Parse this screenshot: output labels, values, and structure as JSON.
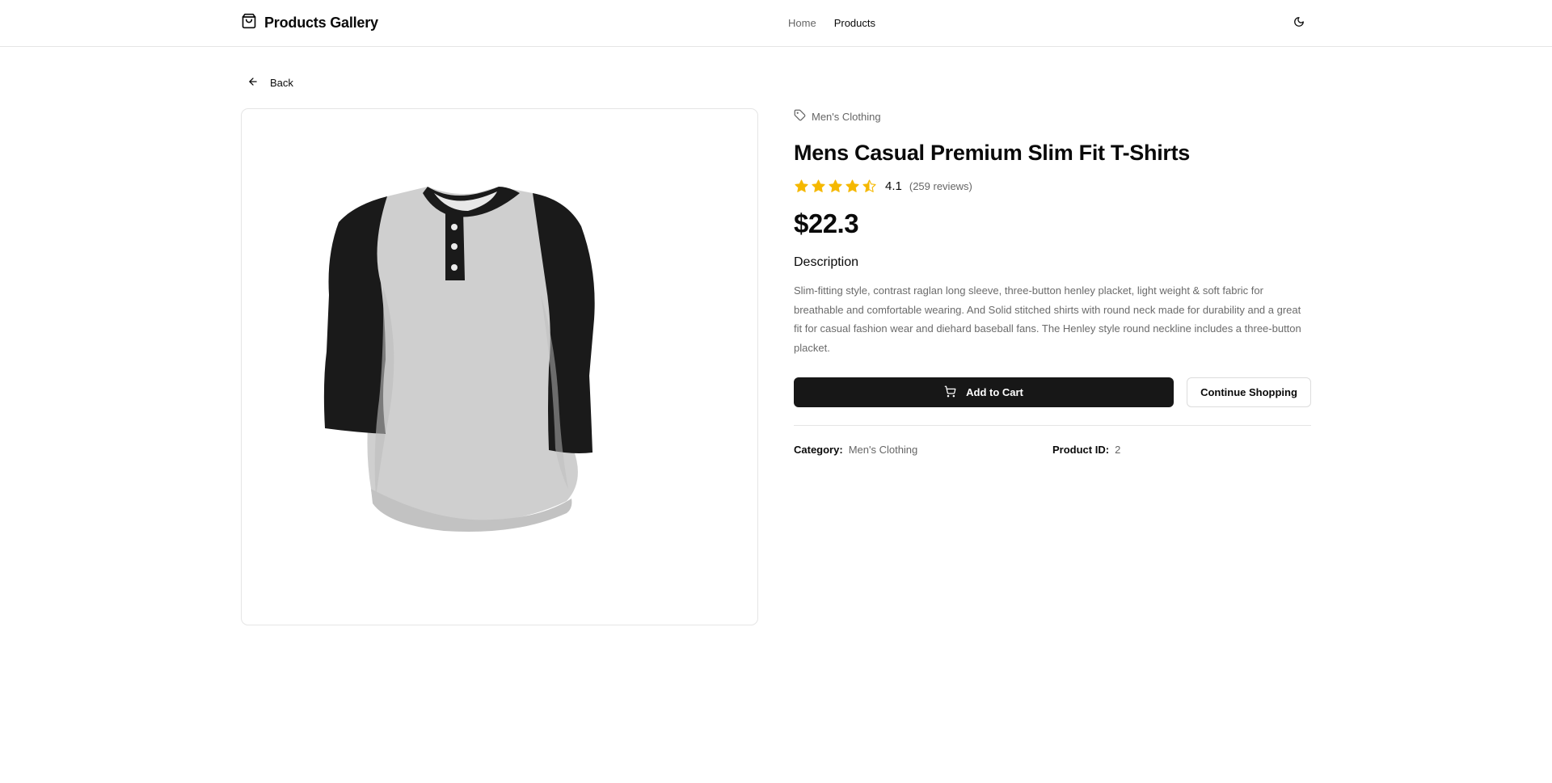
{
  "header": {
    "brand_title": "Products Gallery",
    "brand_icon": "shopping-bag-icon",
    "nav": [
      {
        "label": "Home",
        "active": false
      },
      {
        "label": "Products",
        "active": true
      }
    ],
    "theme_toggle_icon": "moon-icon"
  },
  "back": {
    "label": "Back",
    "icon": "arrow-left-icon"
  },
  "product": {
    "category_tag": "Men's Clothing",
    "category_icon": "tag-icon",
    "title": "Mens Casual Premium Slim Fit T-Shirts",
    "rating": {
      "value": "4.1",
      "count_text": "(259 reviews)",
      "stars_filled": 4,
      "star_partial": 0.5,
      "stars_total": 5,
      "star_color": "#f5b800"
    },
    "price": "$22.3",
    "description_heading": "Description",
    "description": "Slim-fitting style, contrast raglan long sleeve, three-button henley placket, light weight & soft fabric for breathable and comfortable wearing. And Solid stitched shirts with round neck made for durability and a great fit for casual fashion wear and diehard baseball fans. The Henley style round neckline includes a three-button placket.",
    "image_alt": "henley raglan t-shirt image"
  },
  "actions": {
    "add_to_cart": "Add to Cart",
    "add_to_cart_icon": "shopping-cart-icon",
    "continue_shopping": "Continue Shopping"
  },
  "meta": {
    "category_label": "Category:",
    "category_value": "Men's Clothing",
    "id_label": "Product ID:",
    "id_value": "2"
  },
  "colors": {
    "primary_button": "#171717",
    "text": "#0a0a0a",
    "muted_text": "#666666",
    "border": "#e5e5e5"
  }
}
